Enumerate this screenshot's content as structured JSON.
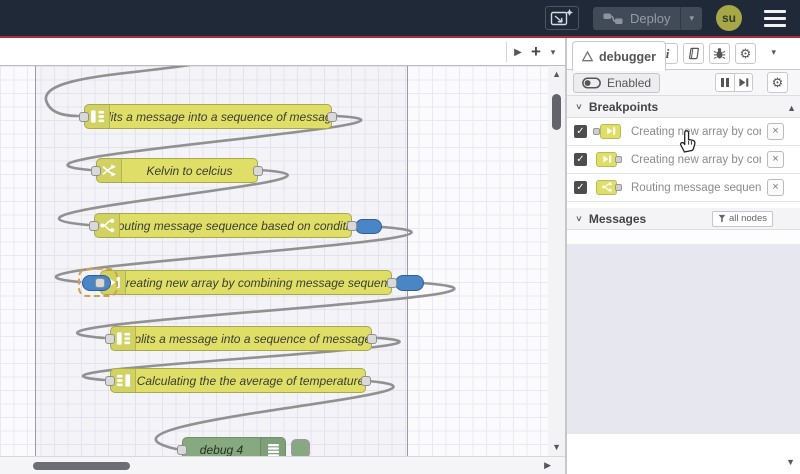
{
  "header": {
    "deploy_label": "Deploy",
    "avatar": "su"
  },
  "canvas": {
    "nodes": [
      {
        "type": "split",
        "label": "Splits a message into a sequence of messages."
      },
      {
        "type": "change",
        "label": "Kelvin to celcius"
      },
      {
        "type": "switch",
        "label": "Routing message sequence based on condition"
      },
      {
        "type": "join",
        "label": "Creating new array by combining message sequence"
      },
      {
        "type": "split",
        "label": "Splits a message into a sequence of messages."
      },
      {
        "type": "join",
        "label": "Calculating the the average of temperature"
      }
    ],
    "debug_node": {
      "label": "debug 4"
    }
  },
  "sidebar": {
    "tab_label": "debugger",
    "toolbar": {
      "enabled_label": "Enabled"
    },
    "breakpoints": {
      "title": "Breakpoints",
      "items": [
        {
          "label": "Creating new array by combining message sequence",
          "checked": true,
          "port_side": "left"
        },
        {
          "label": "Creating new array by combining message sequence",
          "checked": true,
          "port_side": "right"
        },
        {
          "label": "Routing message sequence based on condition",
          "checked": true,
          "port_side": "right"
        }
      ]
    },
    "messages": {
      "title": "Messages",
      "filter_label": "all nodes"
    }
  },
  "icons": {
    "up": "▲",
    "down": "▼",
    "play": "▶",
    "caret": "▾",
    "plus": "+",
    "gear": "⚙",
    "info": "i",
    "close": "×",
    "check": "✓",
    "chevron": "∨"
  },
  "colors": {
    "header_bg": "#202937",
    "accent_red": "#ae2d38",
    "node_yellow": "#dfdf68",
    "node_yellow_border": "#a8a84e",
    "node_green": "#87a980",
    "breakpoint_blue": "#4a86c5",
    "wire": "#919191",
    "avatar_olive": "#a6a747",
    "sidebar_empty": "#e7e8ef"
  }
}
